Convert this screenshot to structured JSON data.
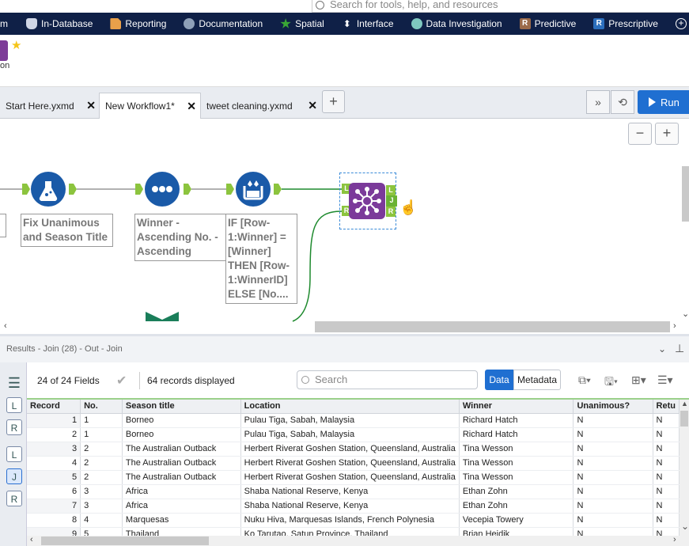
{
  "search": {
    "placeholder": "Search for tools, help, and resources"
  },
  "categories": [
    {
      "label": "m",
      "icon": ""
    },
    {
      "label": "In-Database",
      "icon": "database-icon"
    },
    {
      "label": "Reporting",
      "icon": "reporting-icon"
    },
    {
      "label": "Documentation",
      "icon": "documentation-icon"
    },
    {
      "label": "Spatial",
      "icon": "spatial-icon"
    },
    {
      "label": "Interface",
      "icon": "interface-icon"
    },
    {
      "label": "Data Investigation",
      "icon": "data-investigation-icon"
    },
    {
      "label": "Predictive",
      "icon": "predictive-icon",
      "badge": "R"
    },
    {
      "label": "Prescriptive",
      "icon": "prescriptive-icon",
      "badge": "R"
    }
  ],
  "palette": {
    "label": "on"
  },
  "tabs": [
    {
      "label": "Start Here.yxmd",
      "active": false
    },
    {
      "label": "New Workflow1*",
      "active": true
    },
    {
      "label": "tweet cleaning.yxmd",
      "active": false
    }
  ],
  "toolbar": {
    "run_label": "Run"
  },
  "canvas": {
    "labels": {
      "left_partial": "s",
      "formula1": "Fix Unanimous and Season Title",
      "sort": "Winner - Ascending No. - Ascending",
      "formula2": "IF [Row-1:Winner] = [Winner] THEN [Row-1:WinnerID] ELSE [No...."
    },
    "join_anchors": {
      "left": "L",
      "right": "R",
      "join": "J",
      "out_left": "L",
      "out_right": "R"
    }
  },
  "results": {
    "title": "Results - Join (28) - Out - Join",
    "fields": "24 of 24 Fields",
    "records": "64 records displayed",
    "search_placeholder": "Search",
    "data_label": "Data",
    "metadata_label": "Metadata",
    "left_icons": [
      "L",
      "R",
      "L",
      "J",
      "R"
    ],
    "columns": [
      "Record",
      "No.",
      "Season title",
      "Location",
      "Winner",
      "Unanimous?",
      "Retu"
    ],
    "rows": [
      [
        "1",
        "1",
        "Borneo",
        "Pulau Tiga, Sabah, Malaysia",
        "Richard Hatch",
        "N",
        "N"
      ],
      [
        "2",
        "1",
        "Borneo",
        "Pulau Tiga, Sabah, Malaysia",
        "Richard Hatch",
        "N",
        "N"
      ],
      [
        "3",
        "2",
        "The Australian Outback",
        "Herbert Riverat Goshen Station, Queensland, Australia",
        "Tina Wesson",
        "N",
        "N"
      ],
      [
        "4",
        "2",
        "The Australian Outback",
        "Herbert Riverat Goshen Station, Queensland, Australia",
        "Tina Wesson",
        "N",
        "N"
      ],
      [
        "5",
        "2",
        "The Australian Outback",
        "Herbert Riverat Goshen Station, Queensland, Australia",
        "Tina Wesson",
        "N",
        "N"
      ],
      [
        "6",
        "3",
        "Africa",
        "Shaba National Reserve, Kenya",
        "Ethan Zohn",
        "N",
        "N"
      ],
      [
        "7",
        "3",
        "Africa",
        "Shaba National Reserve, Kenya",
        "Ethan Zohn",
        "N",
        "N"
      ],
      [
        "8",
        "4",
        "Marquesas",
        "Nuku Hiva, Marquesas Islands, French Polynesia",
        "Vecepia Towery",
        "N",
        "N"
      ],
      [
        "9",
        "5",
        "Thailand",
        "Ko Tarutao, Satun Province, Thailand",
        "Brian Heidik",
        "N",
        "N"
      ]
    ]
  }
}
